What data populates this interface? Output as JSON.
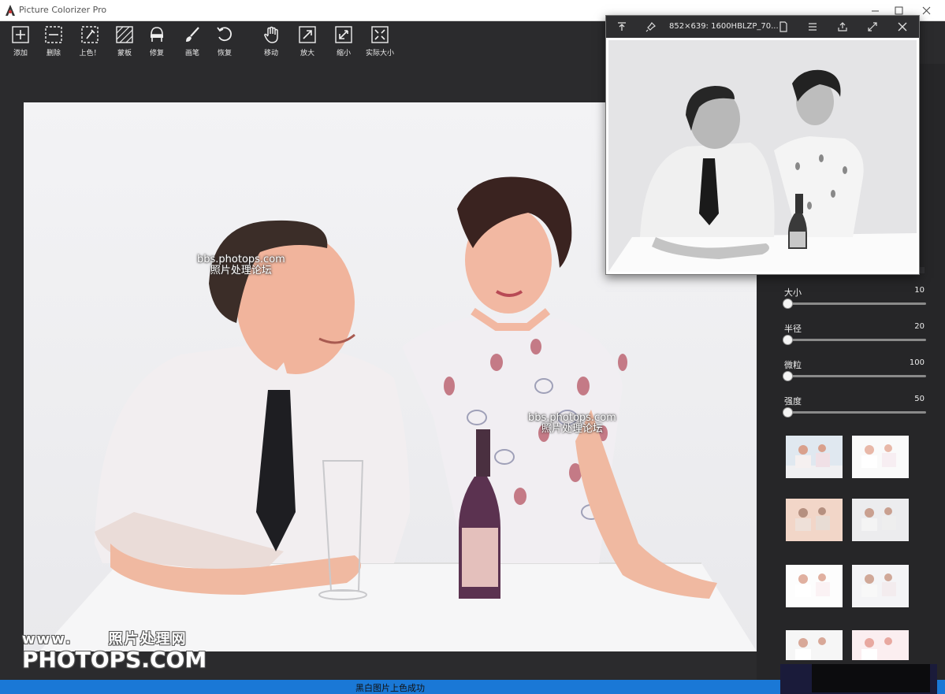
{
  "app": {
    "title": "Picture Colorizer Pro"
  },
  "toolbar": {
    "add": "添加",
    "delete": "删除",
    "colorize": "上色！",
    "mask": "蒙板",
    "repair": "修复",
    "brush": "画笔",
    "restore": "恢复",
    "move": "移动",
    "zoom_in": "放大",
    "zoom_out": "缩小",
    "actual_size": "实际大小"
  },
  "watermarks": {
    "site": "bbs.photops.com",
    "forum": "照片处理论坛",
    "www": "www.",
    "net": "照片处理网",
    "brand": "PHOTOPS.COM"
  },
  "sliders": [
    {
      "name": "大小",
      "value": "10"
    },
    {
      "name": "半径",
      "value": "20"
    },
    {
      "name": "微粒",
      "value": "100"
    },
    {
      "name": "强度",
      "value": "50"
    }
  ],
  "panel_partial_values": [
    "0",
    "0",
    "0",
    "0"
  ],
  "popup": {
    "title": "852×639: 1600HBLZP_70..."
  },
  "status": {
    "text": "黑白图片上色成功"
  },
  "colors": {
    "status_blue": "#1a78d6",
    "bg_dark": "#2b2b2d",
    "panel": "#262628"
  },
  "icons": [
    "add-icon",
    "delete-icon",
    "colorize-icon",
    "mask-icon",
    "repair-icon",
    "brush-icon",
    "restore-icon",
    "move-icon",
    "zoom-in-icon",
    "zoom-out-icon",
    "actual-size-icon"
  ]
}
